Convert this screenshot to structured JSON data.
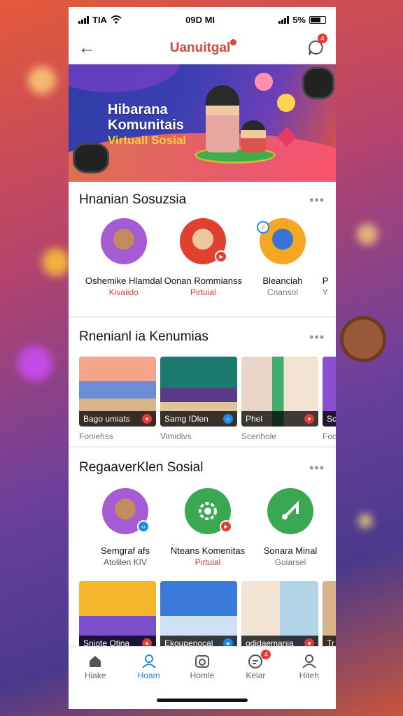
{
  "status": {
    "carrier": "TIA",
    "time": "09D MI",
    "battery": "5%"
  },
  "header": {
    "title": "Uanuitgal",
    "notif_count": "4"
  },
  "banner": {
    "line1": "Hibarana",
    "line2": "Komunitais",
    "line3": "Virtuall Sosial"
  },
  "section1": {
    "title": "Hnanian Sosuzsia",
    "more": "•••",
    "people": [
      {
        "name": "Oshemike Hlamdal",
        "sub": "Kivaiido",
        "color": "#d4473a"
      },
      {
        "name": "Oonan Rommianss",
        "sub": "Pirtuial",
        "color": "#d4473a"
      },
      {
        "name": "Bleanciah",
        "sub": "Cnansol",
        "color": "#777"
      },
      {
        "name": "P",
        "sub": "Y",
        "color": "#777"
      }
    ]
  },
  "section2": {
    "title": "Rnenianl ia Kenumias",
    "more": "•••",
    "cards": [
      {
        "caption": "Bago umiats",
        "sub": "Foniehss"
      },
      {
        "caption": "Samg IDlen",
        "sub": "Vimidivs"
      },
      {
        "caption": "Phel",
        "sub": "Scenhole"
      },
      {
        "caption": "Sc",
        "sub": "Foo"
      }
    ]
  },
  "section3": {
    "title": "RegaaverKlen Sosial",
    "more": "•••",
    "people": [
      {
        "name": "Semgraf afs",
        "sub": "Atolilen KIV",
        "color": "#555"
      },
      {
        "name": "Nteans Komenitas",
        "sub": "Pirtuial",
        "color": "#d4473a"
      },
      {
        "name": "Sonara Minal",
        "sub": "Guiarsel",
        "color": "#777"
      }
    ],
    "cards": [
      {
        "caption": "Sniote Otina"
      },
      {
        "caption": "Ekoupenocal"
      },
      {
        "caption": "odidaemania"
      },
      {
        "caption": "Tr"
      }
    ]
  },
  "tabbar": {
    "tabs": [
      {
        "label": "Hiake",
        "icon": "home-icon"
      },
      {
        "label": "Hoam",
        "icon": "person-icon"
      },
      {
        "label": "Homle",
        "icon": "camera-icon"
      },
      {
        "label": "Kelar",
        "icon": "chat-icon"
      },
      {
        "label": "Hiteh",
        "icon": "profile-icon"
      }
    ],
    "badge": "4"
  },
  "colors": {
    "accent": "#1e88e5",
    "brand": "#d4473a"
  }
}
